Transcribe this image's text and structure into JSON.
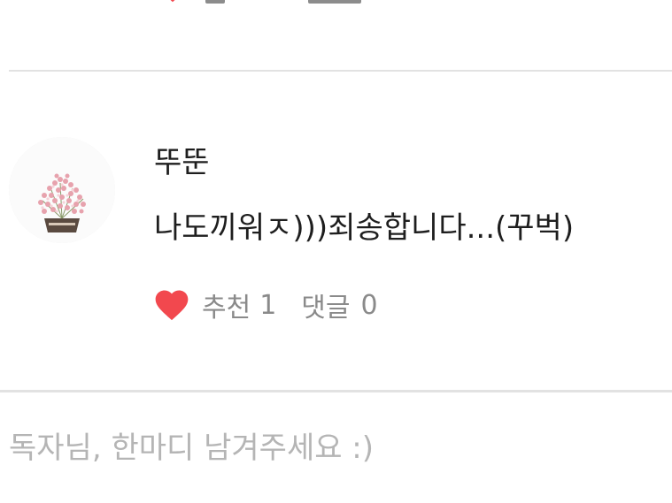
{
  "colors": {
    "heart": "#f2484e",
    "meta_text": "#8a8a8a",
    "body_text": "#1e1e1e",
    "divider": "#e2e2e2",
    "placeholder": "#b5b5b5"
  },
  "comment": {
    "avatar_icon": "flower-bouquet-avatar",
    "author": "뚜뚠",
    "body": "나도끼워ㅈ)))죄송합니다...(꾸벅)",
    "like_icon": "heart-icon",
    "like_label": "추천",
    "like_count": "1",
    "reply_label": "댓글",
    "reply_count": "0"
  },
  "composer": {
    "placeholder": "독자님, 한마디 남겨주세요 :)"
  }
}
